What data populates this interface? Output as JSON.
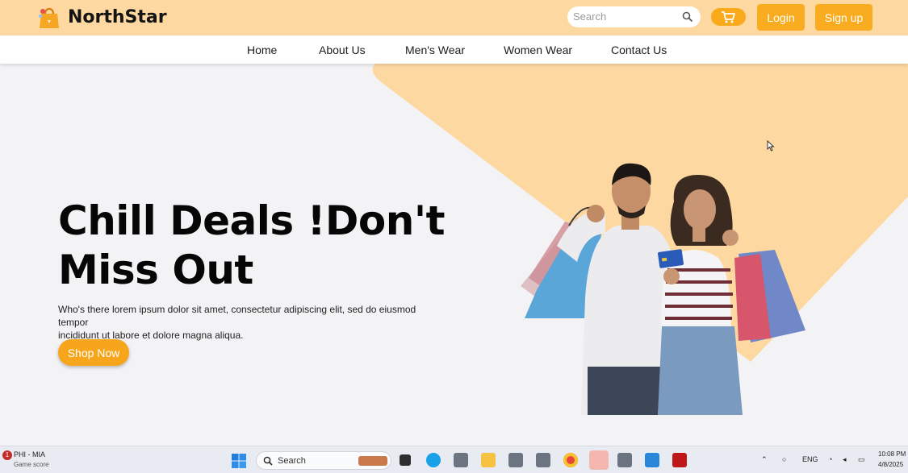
{
  "header": {
    "brand": "NorthStar",
    "search_placeholder": "Search",
    "login_label": "Login",
    "signup_label": "Sign up",
    "brand_color": "#f9ac1f",
    "bar_color": "#fdd8a0"
  },
  "nav": {
    "items": [
      "Home",
      "About Us",
      "Men's Wear",
      "Women Wear",
      "Contact Us"
    ]
  },
  "hero": {
    "title_line1": "Chill Deals !Don't",
    "title_line2": "Miss Out",
    "description_line1": "Who's there lorem ipsum dolor sit amet, consectetur adipiscing elit, sed do eiusmod tempor",
    "description_line2": "incididunt ut labore et dolore magna aliqua.",
    "cta_label": "Shop Now",
    "image": "couple-with-shopping-bags"
  },
  "taskbar": {
    "widget_title": "PHI - MIA",
    "widget_subtitle": "Game score",
    "widget_badge": "1",
    "search_label": "Search",
    "language": "ENG",
    "time": "10:08 PM",
    "date": "4/8/2025",
    "apps": [
      "task-view",
      "edge",
      "app",
      "file-explorer",
      "app",
      "app",
      "chrome",
      "chrome-profile",
      "app",
      "vscode",
      "mcafee"
    ]
  }
}
